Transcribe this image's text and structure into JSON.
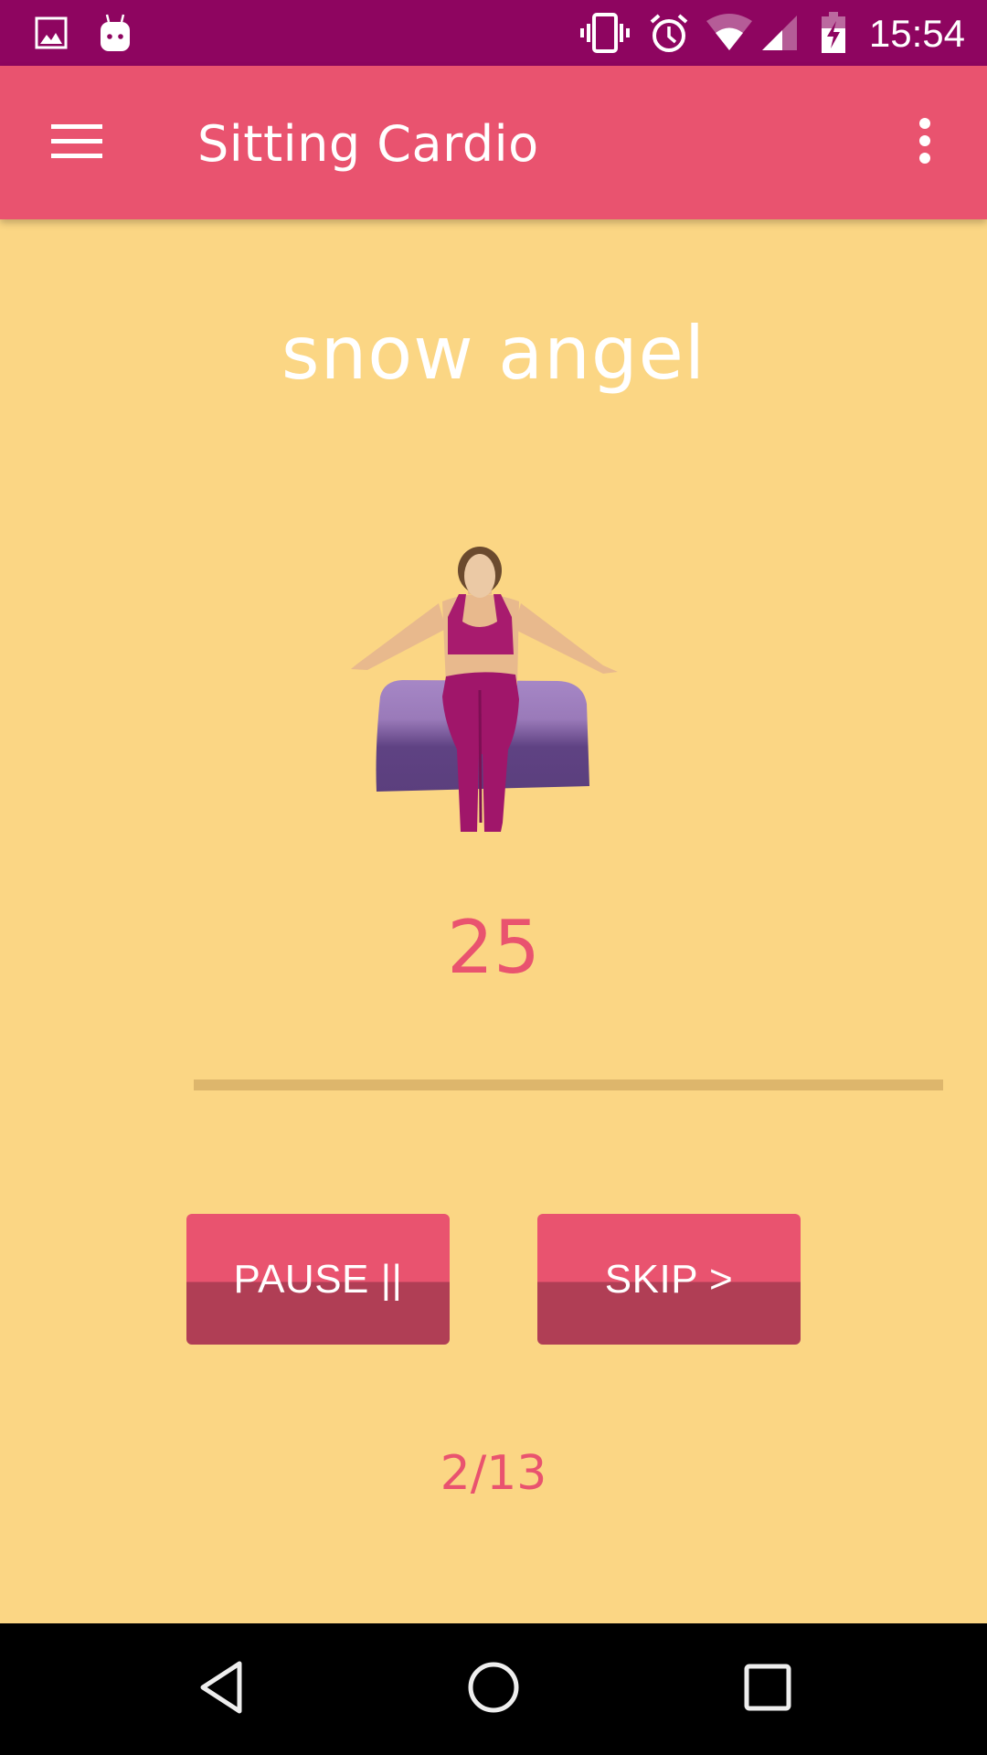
{
  "status_bar": {
    "time": "15:54",
    "icons": [
      "gallery-icon",
      "android-debug-icon",
      "vibrate-icon",
      "alarm-icon",
      "wifi-icon",
      "cell-signal-icon",
      "battery-charging-icon"
    ]
  },
  "app_bar": {
    "title": "Sitting Cardio",
    "menu_icon": "hamburger-menu-icon",
    "overflow_icon": "more-vert-icon"
  },
  "workout": {
    "exercise_name": "snow angel",
    "illustration": "woman seated on purple cushion with arms extended",
    "timer_value": "25",
    "progress_percent": 0,
    "pause_label": "PAUSE ||",
    "skip_label": "SKIP >",
    "step_counter": "2/13"
  },
  "colors": {
    "status_bar": "#8E0560",
    "primary": "#E9536F",
    "primary_dark": "#B03E55",
    "background": "#FBD684",
    "progress_track": "#DDB66C"
  },
  "nav_bar": {
    "back_icon": "back-icon",
    "home_icon": "home-icon",
    "recents_icon": "recents-icon"
  }
}
